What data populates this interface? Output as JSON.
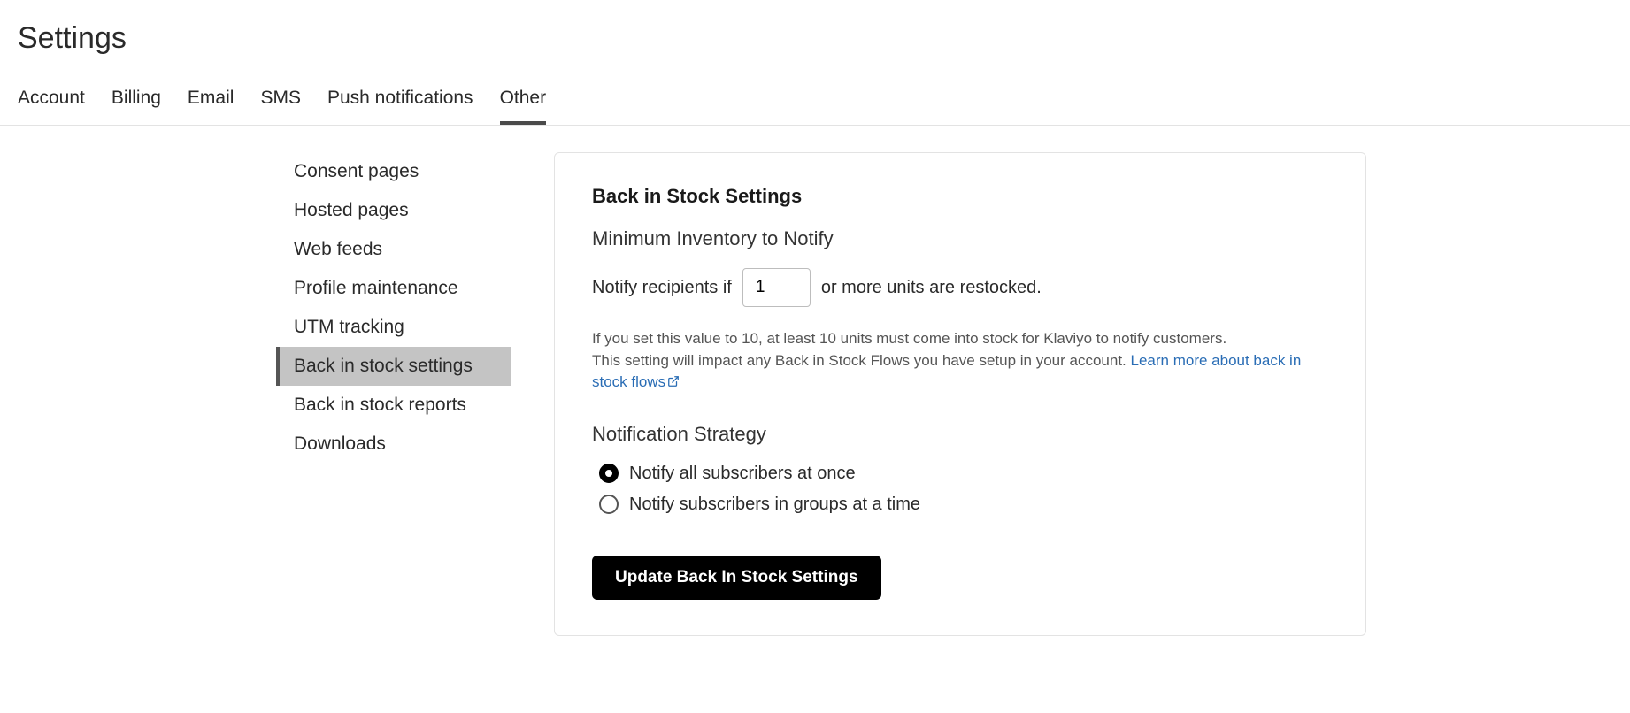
{
  "title": "Settings",
  "tabs": [
    {
      "label": "Account",
      "active": false
    },
    {
      "label": "Billing",
      "active": false
    },
    {
      "label": "Email",
      "active": false
    },
    {
      "label": "SMS",
      "active": false
    },
    {
      "label": "Push notifications",
      "active": false
    },
    {
      "label": "Other",
      "active": true
    }
  ],
  "sidebar": {
    "items": [
      {
        "label": "Consent pages",
        "active": false
      },
      {
        "label": "Hosted pages",
        "active": false
      },
      {
        "label": "Web feeds",
        "active": false
      },
      {
        "label": "Profile maintenance",
        "active": false
      },
      {
        "label": "UTM tracking",
        "active": false
      },
      {
        "label": "Back in stock settings",
        "active": true
      },
      {
        "label": "Back in stock reports",
        "active": false
      },
      {
        "label": "Downloads",
        "active": false
      }
    ]
  },
  "panel": {
    "heading": "Back in Stock Settings",
    "min_inventory": {
      "subheading": "Minimum Inventory to Notify",
      "prefix": "Notify recipients if",
      "value": "1",
      "suffix": "or more units are restocked.",
      "helper_line1": "If you set this value to 10, at least 10 units must come into stock for Klaviyo to notify customers.",
      "helper_line2": "This setting will impact any Back in Stock Flows you have setup in your account. ",
      "helper_link": "Learn more about back in stock flows"
    },
    "strategy": {
      "subheading": "Notification Strategy",
      "options": [
        {
          "label": "Notify all subscribers at once",
          "selected": true
        },
        {
          "label": "Notify subscribers in groups at a time",
          "selected": false
        }
      ]
    },
    "submit_label": "Update Back In Stock Settings"
  }
}
